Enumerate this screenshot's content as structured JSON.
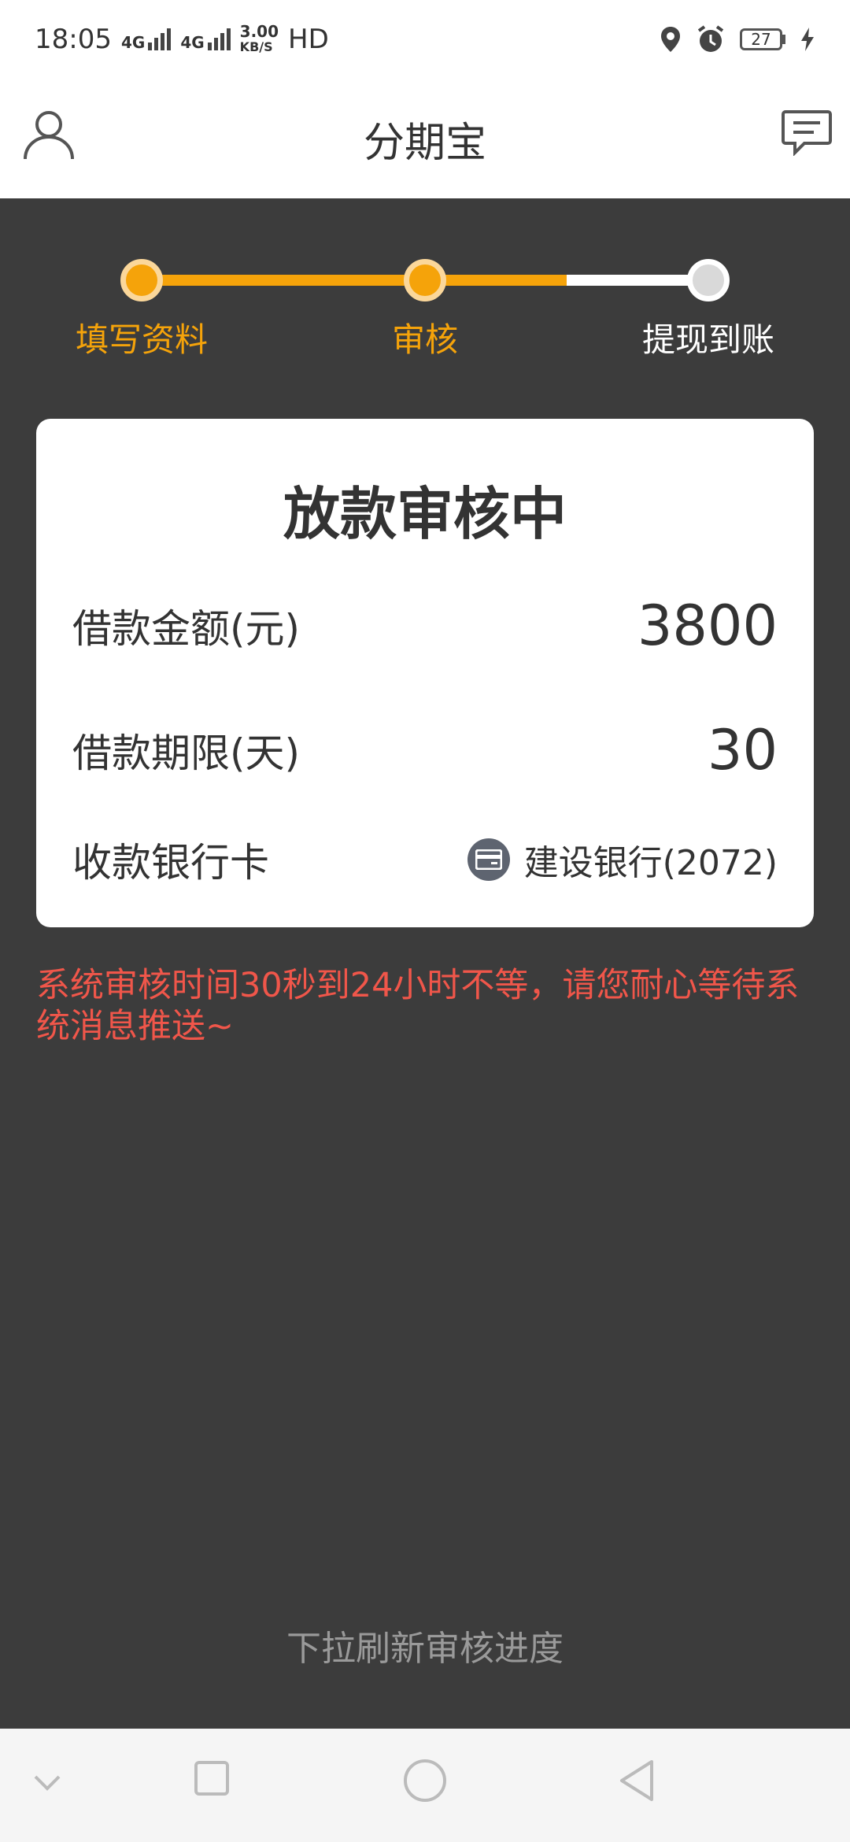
{
  "status_bar": {
    "time": "18:05",
    "net1": "4G",
    "net2": "4G",
    "speed_value": "3.00",
    "speed_unit": "KB/S",
    "hd": "HD",
    "battery": "27",
    "icons": [
      "location-icon",
      "alarm-icon",
      "battery-icon",
      "charging-icon"
    ]
  },
  "header": {
    "title": "分期宝",
    "left_icon": "user-icon",
    "right_icon": "message-icon"
  },
  "steps": [
    {
      "label": "填写资料",
      "state": "done"
    },
    {
      "label": "审核",
      "state": "current"
    },
    {
      "label": "提现到账",
      "state": "pending"
    }
  ],
  "progress_fraction": 0.75,
  "colors": {
    "accent": "#f5a30a",
    "notice": "#f0564a",
    "background": "#3c3c3c"
  },
  "card": {
    "title": "放款审核中",
    "rows": [
      {
        "label": "借款金额(元)",
        "value": "3800"
      },
      {
        "label": "借款期限(天)",
        "value": "30"
      },
      {
        "label": "收款银行卡",
        "value": "建设银行(2072)",
        "icon": "bank-card-icon"
      }
    ]
  },
  "notice": "系统审核时间30秒到24小时不等，请您耐心等待系统消息推送~",
  "pull_hint": "下拉刷新审核进度",
  "nav_bar": {
    "buttons": [
      "collapse-icon",
      "recents-icon",
      "home-icon",
      "back-icon"
    ]
  }
}
